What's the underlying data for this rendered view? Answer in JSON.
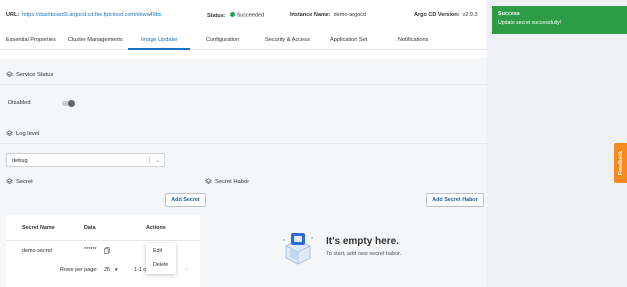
{
  "info": {
    "url_label": "URL:",
    "url_value": "https://dashboard3.argocd.cd.fke.fptcloud.com/ebwa49bx",
    "status_label": "Status:",
    "status_value": "Succeeded",
    "instance_label": "Instance Name:",
    "instance_value": "demo-argocd",
    "version_label": "Argo CD Version:",
    "version_value": "v2.9.3"
  },
  "tabs": [
    "Essential Properties",
    "Cluster Managements",
    "Image Updater",
    "Configuration",
    "Security & Access",
    "Application Set",
    "Notifications"
  ],
  "active_tab": "Image Updater",
  "service_status": {
    "label": "Service Status",
    "state": "Disabled"
  },
  "log_level": {
    "label": "Log level",
    "value": "debug"
  },
  "secret": {
    "label": "Secret",
    "add_button": "Add Secret",
    "columns": [
      "Secret Name",
      "Data",
      "Actions"
    ],
    "rows": [
      {
        "name": "demo-secret",
        "data": "******"
      }
    ],
    "rows_per_page_label": "Rows per page:",
    "rows_per_page_value": "25",
    "range": "1-1 of 1"
  },
  "action_menu": [
    "Edit",
    "Delete"
  ],
  "secret_harbor": {
    "label": "Secret Habor",
    "add_button": "Add Secret Habor",
    "empty_title": "It's empty here.",
    "empty_sub": "To start, add new secret habor."
  },
  "toast": {
    "title": "Success",
    "message": "Update secret successfully!"
  },
  "feedback_label": "Feedback",
  "colors": {
    "accent": "#1a73c8",
    "success": "#2e9b47",
    "feedback": "#f58a1f"
  }
}
